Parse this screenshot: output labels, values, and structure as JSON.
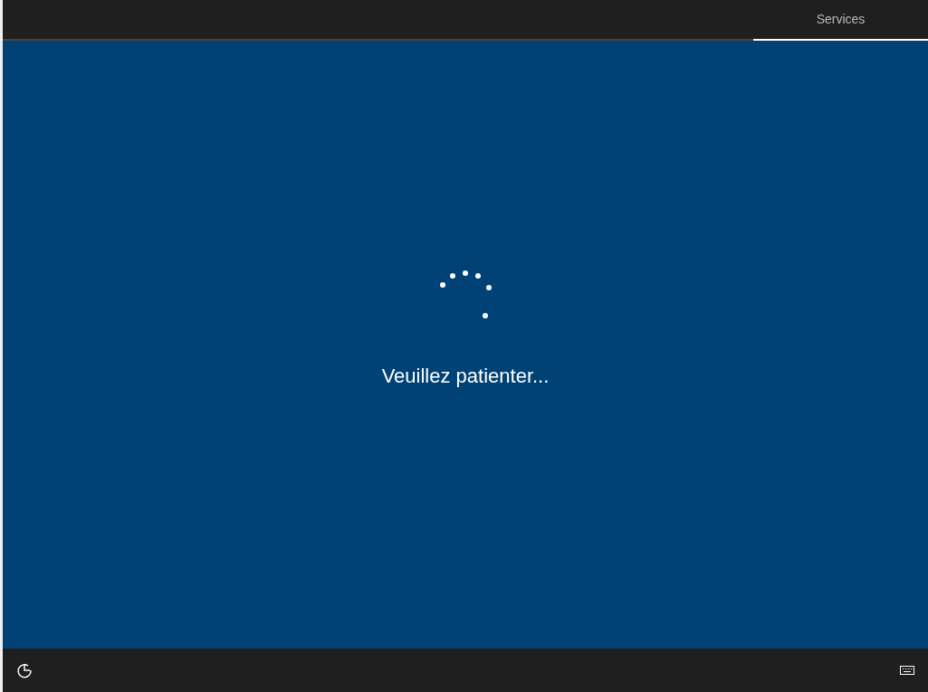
{
  "tabs": [
    {
      "label": "Services",
      "selected": true
    }
  ],
  "message": "Veuillez patienter..."
}
